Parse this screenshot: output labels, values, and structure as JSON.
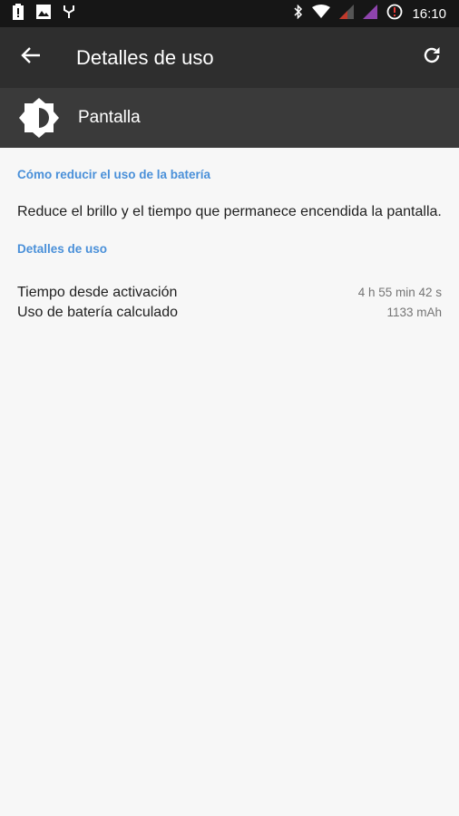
{
  "status_bar": {
    "time": "16:10",
    "icons": [
      "battery-alert-icon",
      "image-icon",
      "usb-icon",
      "bluetooth-icon",
      "wifi-icon",
      "signal-icon",
      "signal-icon",
      "alert-icon"
    ],
    "colors": {
      "signal1": "#c0392b",
      "signal2": "#8e44ad"
    }
  },
  "app_bar": {
    "title": "Detalles de uso",
    "back_icon": "arrow-back-icon",
    "refresh_icon": "refresh-icon"
  },
  "header": {
    "label": "Pantalla",
    "icon": "brightness-icon"
  },
  "tip": {
    "title": "Cómo reducir el uso de la batería",
    "text": "Reduce el brillo y el tiempo que permanece encendida la pantalla."
  },
  "usage": {
    "title": "Detalles de uso",
    "rows": [
      {
        "label": "Tiempo desde activación",
        "value": "4 h 55 min 42 s"
      },
      {
        "label": "Uso de batería calculado",
        "value": "1133 mAh"
      }
    ]
  },
  "colors": {
    "accent": "#4a90d9",
    "app_bar": "#2e2e2e",
    "header_bg": "#3a3a3a"
  }
}
